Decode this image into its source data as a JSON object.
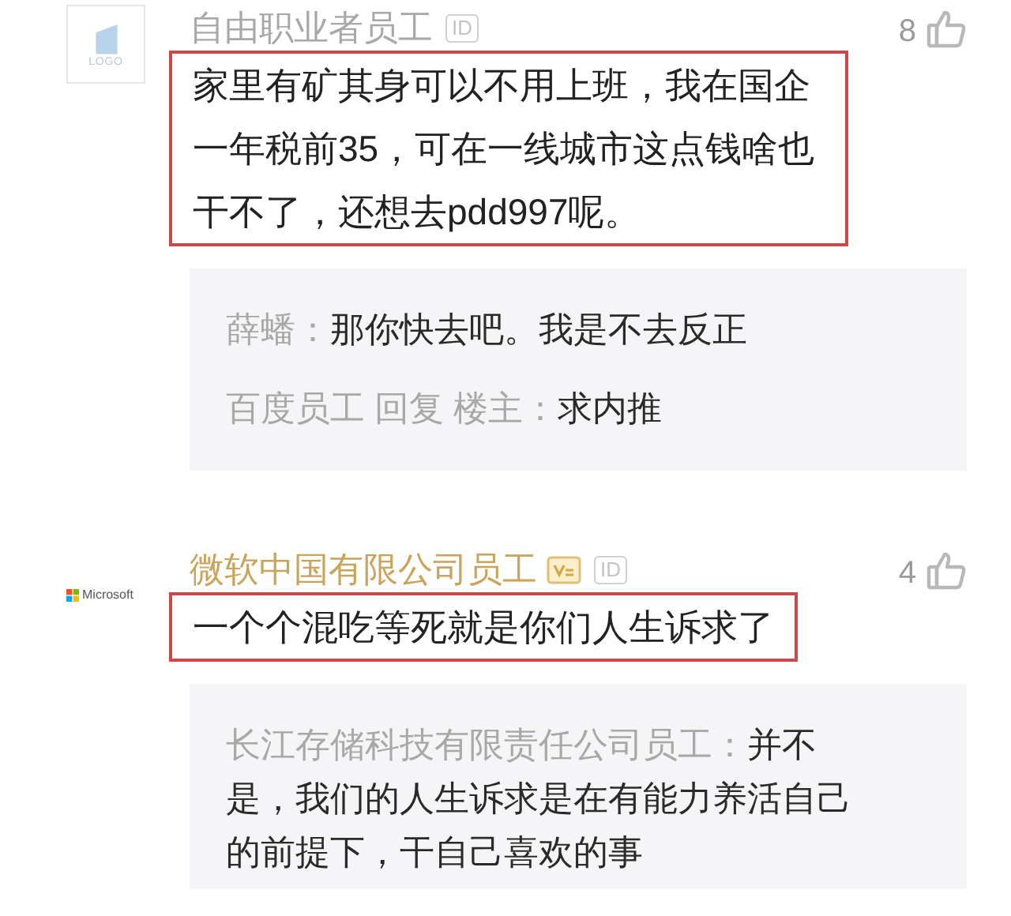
{
  "comments": [
    {
      "avatar": {
        "kind": "placeholder",
        "text": "LOGO"
      },
      "name": "自由职业者员工",
      "verified": false,
      "badge": "ID",
      "likes": "8",
      "highlighted": true,
      "text": "家里有矿其身可以不用上班，我在国企一年税前35，可在一线城市这点钱啥也干不了，还想去pdd997呢。",
      "replies": [
        {
          "author": "薛蟠：",
          "text": "那你快去吧。我是不去反正"
        },
        {
          "author": "百度员工 回复 楼主：",
          "text": "求内推"
        }
      ]
    },
    {
      "avatar": {
        "kind": "microsoft",
        "text": "Microsoft"
      },
      "name": "微软中国有限公司员工",
      "verified": true,
      "badge": "ID",
      "likes": "4",
      "highlighted": true,
      "text": "一个个混吃等死就是你们人生诉求了",
      "replies": [
        {
          "author": "长江存储科技有限责任公司员工：",
          "text": "并不是，我们的人生诉求是在有能力养活自己的前提下，干自己喜欢的事"
        }
      ]
    }
  ]
}
